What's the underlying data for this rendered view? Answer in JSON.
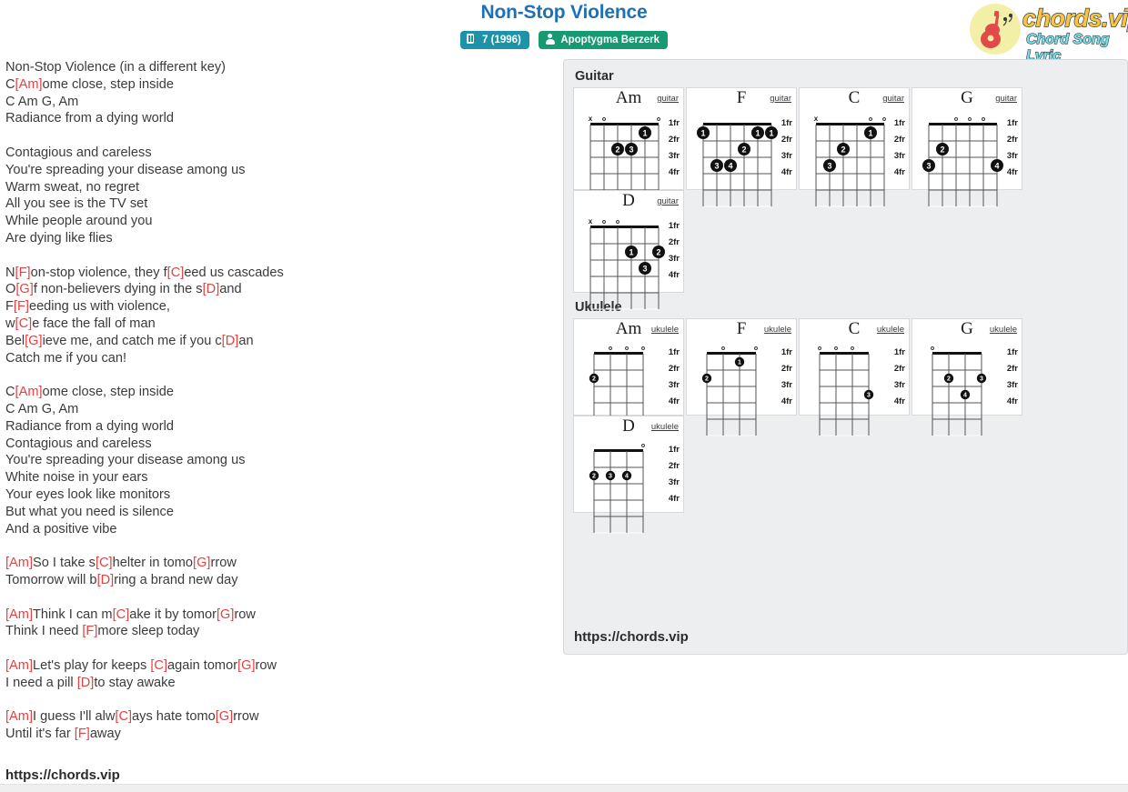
{
  "header": {
    "title": "Non-Stop Violence",
    "badges": [
      {
        "icon": "book-icon",
        "label": "7 (1996)",
        "color": "#1c93a8"
      },
      {
        "icon": "person-icon",
        "label": "Apoptygma Berzerk",
        "color": "#159a74"
      }
    ]
  },
  "logo": {
    "name": "chords.vip",
    "tagline": "Chord Song Lyric",
    "icon": "guitar-icon",
    "circle_color": "#f2f0a8",
    "name_color": "#f6c643",
    "tagline_color": "#77e0ef"
  },
  "lyrics": {
    "chord_color": "#e8413f",
    "lines": [
      [
        {
          "t": "Non-Stop Violence (in a different key)"
        }
      ],
      [
        {
          "t": "C"
        },
        {
          "c": "[Am]"
        },
        {
          "t": "ome close, step inside"
        }
      ],
      [
        {
          "t": "C Am G, Am"
        }
      ],
      [
        {
          "t": "Radiance from a dying world"
        }
      ],
      [],
      [
        {
          "t": "Contagious and careless"
        }
      ],
      [
        {
          "t": "You're spreading your disease among us"
        }
      ],
      [
        {
          "t": "Warm sweat, no regret"
        }
      ],
      [
        {
          "t": "All you see is the TV set"
        }
      ],
      [
        {
          "t": "While people around you"
        }
      ],
      [
        {
          "t": "Are dying like flies"
        }
      ],
      [],
      [
        {
          "t": "N"
        },
        {
          "c": "[F]"
        },
        {
          "t": "on-stop violence, they f"
        },
        {
          "c": "[C]"
        },
        {
          "t": "eed us cascades"
        }
      ],
      [
        {
          "t": "O"
        },
        {
          "c": "[G]"
        },
        {
          "t": "f non-believers dying in the s"
        },
        {
          "c": "[D]"
        },
        {
          "t": "and"
        }
      ],
      [
        {
          "t": "F"
        },
        {
          "c": "[F]"
        },
        {
          "t": "eeding us with violence,"
        }
      ],
      [
        {
          "t": "w"
        },
        {
          "c": "[C]"
        },
        {
          "t": "e face the fall of man"
        }
      ],
      [
        {
          "t": "Bel"
        },
        {
          "c": "[G]"
        },
        {
          "t": "ieve me, and catch me if you c"
        },
        {
          "c": "[D]"
        },
        {
          "t": "an"
        }
      ],
      [
        {
          "t": "Catch me if you can!"
        }
      ],
      [],
      [
        {
          "t": "C"
        },
        {
          "c": "[Am]"
        },
        {
          "t": "ome close, step inside"
        }
      ],
      [
        {
          "t": "C Am G, Am"
        }
      ],
      [
        {
          "t": "Radiance from a dying world"
        }
      ],
      [
        {
          "t": "Contagious and careless"
        }
      ],
      [
        {
          "t": "You're spreading your disease among us"
        }
      ],
      [
        {
          "t": "White noise in your ears"
        }
      ],
      [
        {
          "t": "Your eyes look like monitors"
        }
      ],
      [
        {
          "t": "But what you need is silence"
        }
      ],
      [
        {
          "t": "And a positive vibe"
        }
      ],
      [],
      [
        {
          "c": "[Am]"
        },
        {
          "t": "So I take s"
        },
        {
          "c": "[C]"
        },
        {
          "t": "helter in tomo"
        },
        {
          "c": "[G]"
        },
        {
          "t": "rrow"
        }
      ],
      [
        {
          "t": "Tomorrow will b"
        },
        {
          "c": "[D]"
        },
        {
          "t": "ring a brand new day"
        }
      ],
      [],
      [
        {
          "c": "[Am]"
        },
        {
          "t": "Think I can m"
        },
        {
          "c": "[C]"
        },
        {
          "t": "ake it by tomor"
        },
        {
          "c": "[G]"
        },
        {
          "t": "row"
        }
      ],
      [
        {
          "t": "Think I need "
        },
        {
          "c": "[F]"
        },
        {
          "t": "more sleep today"
        }
      ],
      [],
      [
        {
          "c": "[Am]"
        },
        {
          "t": "Let's play for keeps "
        },
        {
          "c": "[C]"
        },
        {
          "t": "again tomor"
        },
        {
          "c": "[G]"
        },
        {
          "t": "row"
        }
      ],
      [
        {
          "t": "I need a pill "
        },
        {
          "c": "[D]"
        },
        {
          "t": "to stay awake"
        }
      ],
      [],
      [
        {
          "c": "[Am]"
        },
        {
          "t": "I guess I'll alw"
        },
        {
          "c": "[C]"
        },
        {
          "t": "ays hate tomo"
        },
        {
          "c": "[G]"
        },
        {
          "t": "rrow"
        }
      ],
      [
        {
          "t": "Until it's far "
        },
        {
          "c": "[F]"
        },
        {
          "t": "away"
        }
      ]
    ]
  },
  "site_link": "https://chords.vip",
  "panel": {
    "guitar_heading": "Guitar",
    "ukulele_heading": "Ukulele",
    "fret_labels": [
      "1fr",
      "2fr",
      "3fr",
      "4fr"
    ],
    "guitar_label": "guitar",
    "ukulele_label": "ukulele",
    "guitar_chords": [
      {
        "name": "Am",
        "instrument": "guitar",
        "strings": 6,
        "open_marks": [
          "x",
          "o",
          "",
          "",
          "",
          "o"
        ],
        "dots": [
          {
            "string": 5,
            "fret": 1,
            "finger": "1"
          },
          {
            "string": 3,
            "fret": 2,
            "finger": "2"
          },
          {
            "string": 4,
            "fret": 2,
            "finger": "3"
          }
        ]
      },
      {
        "name": "F",
        "instrument": "guitar",
        "strings": 6,
        "open_marks": [
          "",
          "",
          "",
          "",
          "",
          ""
        ],
        "dots": [
          {
            "string": 1,
            "fret": 1,
            "finger": "1"
          },
          {
            "string": 5,
            "fret": 1,
            "finger": "1"
          },
          {
            "string": 6,
            "fret": 1,
            "finger": "1"
          },
          {
            "string": 4,
            "fret": 2,
            "finger": "2"
          },
          {
            "string": 2,
            "fret": 3,
            "finger": "3"
          },
          {
            "string": 3,
            "fret": 3,
            "finger": "4"
          }
        ]
      },
      {
        "name": "C",
        "instrument": "guitar",
        "strings": 6,
        "open_marks": [
          "x",
          "",
          "",
          "",
          "o",
          "o"
        ],
        "dots": [
          {
            "string": 5,
            "fret": 1,
            "finger": "1"
          },
          {
            "string": 3,
            "fret": 2,
            "finger": "2"
          },
          {
            "string": 2,
            "fret": 3,
            "finger": "3"
          }
        ]
      },
      {
        "name": "G",
        "instrument": "guitar",
        "strings": 6,
        "open_marks": [
          "",
          "",
          "o",
          "o",
          "o",
          ""
        ],
        "dots": [
          {
            "string": 2,
            "fret": 2,
            "finger": "2"
          },
          {
            "string": 1,
            "fret": 3,
            "finger": "3"
          },
          {
            "string": 6,
            "fret": 3,
            "finger": "4"
          }
        ]
      },
      {
        "name": "D",
        "instrument": "guitar",
        "strings": 6,
        "open_marks": [
          "x",
          "o",
          "o",
          "",
          "",
          ""
        ],
        "dots": [
          {
            "string": 4,
            "fret": 2,
            "finger": "1"
          },
          {
            "string": 6,
            "fret": 2,
            "finger": "2"
          },
          {
            "string": 5,
            "fret": 3,
            "finger": "3"
          }
        ]
      }
    ],
    "ukulele_chords": [
      {
        "name": "Am",
        "instrument": "ukulele",
        "strings": 4,
        "open_marks": [
          "",
          "o",
          "o",
          "o"
        ],
        "dots": [
          {
            "string": 1,
            "fret": 2,
            "finger": "2"
          }
        ]
      },
      {
        "name": "F",
        "instrument": "ukulele",
        "strings": 4,
        "open_marks": [
          "",
          "o",
          "",
          "o"
        ],
        "dots": [
          {
            "string": 3,
            "fret": 1,
            "finger": "1"
          },
          {
            "string": 1,
            "fret": 2,
            "finger": "2"
          }
        ]
      },
      {
        "name": "C",
        "instrument": "ukulele",
        "strings": 4,
        "open_marks": [
          "o",
          "o",
          "o",
          ""
        ],
        "dots": [
          {
            "string": 4,
            "fret": 3,
            "finger": "3"
          }
        ]
      },
      {
        "name": "G",
        "instrument": "ukulele",
        "strings": 4,
        "open_marks": [
          "o",
          "",
          "",
          ""
        ],
        "dots": [
          {
            "string": 2,
            "fret": 2,
            "finger": "2"
          },
          {
            "string": 4,
            "fret": 2,
            "finger": "3"
          },
          {
            "string": 3,
            "fret": 3,
            "finger": "4"
          }
        ]
      },
      {
        "name": "D",
        "instrument": "ukulele",
        "strings": 4,
        "open_marks": [
          "",
          "",
          "",
          "o"
        ],
        "dots": [
          {
            "string": 1,
            "fret": 2,
            "finger": "2"
          },
          {
            "string": 2,
            "fret": 2,
            "finger": "3"
          },
          {
            "string": 3,
            "fret": 2,
            "finger": "4"
          }
        ]
      }
    ]
  }
}
